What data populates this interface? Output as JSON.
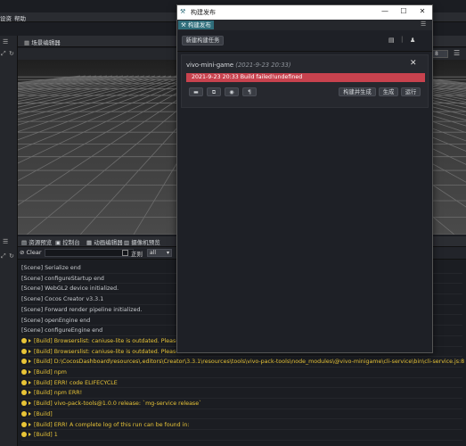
{
  "menu": {
    "left_label": "设资",
    "help": "帮助"
  },
  "scene": {
    "tab_label": "场景编辑器",
    "right_label": "8"
  },
  "bottom_tabs": [
    "资源预览",
    "控制台",
    "动画编辑器",
    "摄像机预览"
  ],
  "console_toolbar": {
    "clear": "Clear",
    "regex": "正则",
    "filter_value": "all"
  },
  "logs": [
    {
      "level": "info",
      "text": "[Scene] Serialize end"
    },
    {
      "level": "info",
      "text": "[Scene] configureStartup end"
    },
    {
      "level": "info",
      "text": "[Scene] WebGL2 device initialized."
    },
    {
      "level": "info",
      "text": "[Scene] Cocos Creator v3.3.1"
    },
    {
      "level": "info",
      "text": "[Scene] Forward render pipeline initialized."
    },
    {
      "level": "info",
      "text": "[Scene] openEngine end"
    },
    {
      "level": "info",
      "text": "[Scene] configureEngine end"
    },
    {
      "level": "warn",
      "text": "[Build] Browserslist: caniuse-lite is outdated. Please run:"
    },
    {
      "level": "warn",
      "text": "[Build] Browserslist: caniuse-lite is outdated. Please run:"
    },
    {
      "level": "warn",
      "text": "[Build] D:\\CocosDashboard\\resources\\.editors\\Creator\\3.3.1\\resources\\tools\\vivo-pack-tools\\node_modules\\@vivo-minigame\\cli-service\\bin\\cli-service.js:8"
    },
    {
      "level": "warn",
      "text": "[Build] npm"
    },
    {
      "level": "warn",
      "text": "[Build] ERR! code ELIFECYCLE"
    },
    {
      "level": "warn",
      "text": "[Build] npm ERR!"
    },
    {
      "level": "warn",
      "text": "[Build] vivo-pack-tools@1.0.0 release: `mg-service release`"
    },
    {
      "level": "warn",
      "text": "[Build]"
    },
    {
      "level": "warn",
      "text": "[Build] ERR! A complete log of this run can be found in:"
    },
    {
      "level": "warn",
      "text": "[Build] 1"
    }
  ],
  "dialog": {
    "title": "构建发布",
    "tab_label": "构建发布",
    "new_task": "新建构建任务",
    "task": {
      "name": "vivo-mini-game",
      "time": "(2021-9-23 20:33)",
      "status": "2021-9-23 20:33 Build failed!undefined",
      "build_and_generate": "构建并生成",
      "generate": "生成",
      "run": "运行",
      "status_color": "#c8424e"
    }
  }
}
